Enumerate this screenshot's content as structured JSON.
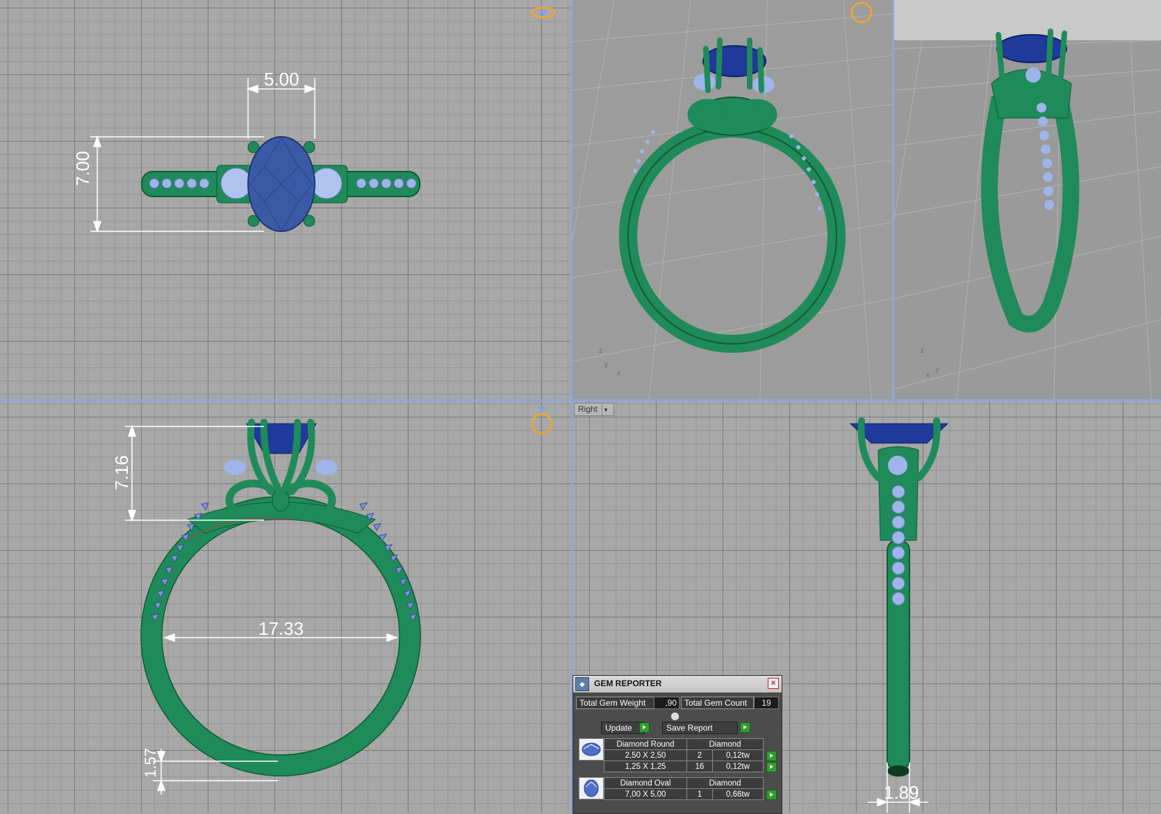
{
  "dimensions": {
    "top_width": "5.00",
    "top_length": "7.00",
    "front_head_height": "7.16",
    "front_inner_diameter": "17.33",
    "front_shank_thickness": "1.57",
    "right_shank_width": "1.89"
  },
  "right_view": {
    "label": "Right"
  },
  "axes": {
    "z": "z",
    "y": "y",
    "x": "x"
  },
  "gem_reporter": {
    "title": "GEM REPORTER",
    "total_weight_label": "Total Gem Weight",
    "total_weight_value": ",90",
    "total_count_label": "Total Gem Count",
    "total_count_value": "19",
    "update_label": "Update",
    "save_label": "Save Report",
    "groups": [
      {
        "shape": "Diamond Round",
        "material": "Diamond",
        "rows": [
          {
            "size": "2,50 X 2,50",
            "count": "2",
            "weight": "0,12tw"
          },
          {
            "size": "1,25 X 1,25",
            "count": "16",
            "weight": "0,12tw"
          }
        ]
      },
      {
        "shape": "Diamond Oval",
        "material": "Diamond",
        "rows": [
          {
            "size": "7,00 X 5,00",
            "count": "1",
            "weight": "0,66tw"
          }
        ]
      }
    ]
  },
  "colors": {
    "metal": "#1f8a5a",
    "metal_dark": "#0f5a36",
    "center_stone": "#3a5aa8",
    "side_stones": "#9fb4e8",
    "grid_bg": "#a8a8a8",
    "viewport_separator": "#8fa7d8"
  }
}
